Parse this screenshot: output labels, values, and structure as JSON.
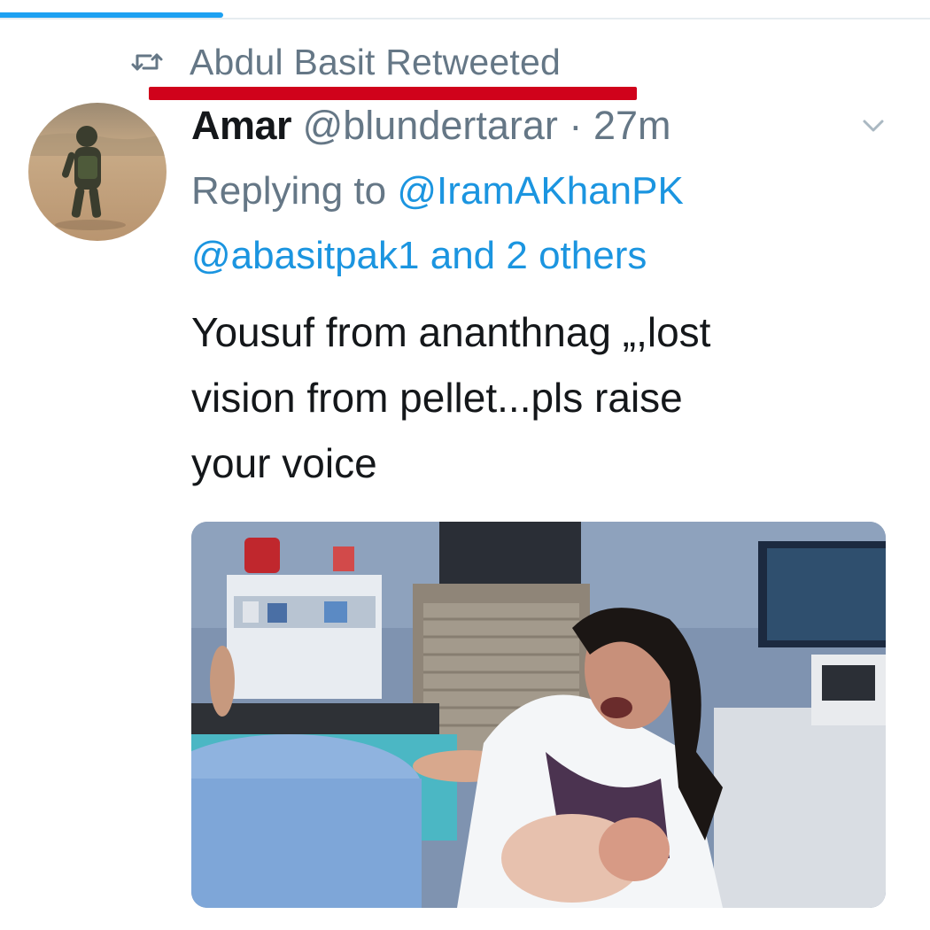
{
  "social_context": {
    "retweet_label": "Abdul Basit Retweeted"
  },
  "tweet": {
    "display_name": "Amar",
    "handle": "@blundertarar",
    "separator": "·",
    "time": "27m",
    "replying_prefix": "Replying to",
    "reply_mention_1": "@IramAKhanPK",
    "reply_mention_2": "@abasitpak1",
    "reply_others": "and 2 others",
    "text_lines": [
      "Yousuf from ananthnag „,lost",
      "vision from pellet...pls raise",
      "your voice"
    ]
  },
  "icons": {
    "retweet": "retweet-icon",
    "menu": "chevron-down-icon"
  },
  "colors": {
    "accent": "#1da1f2",
    "mention": "#1b95e0",
    "secondary_text": "#657786",
    "annotation": "#d0021b"
  }
}
